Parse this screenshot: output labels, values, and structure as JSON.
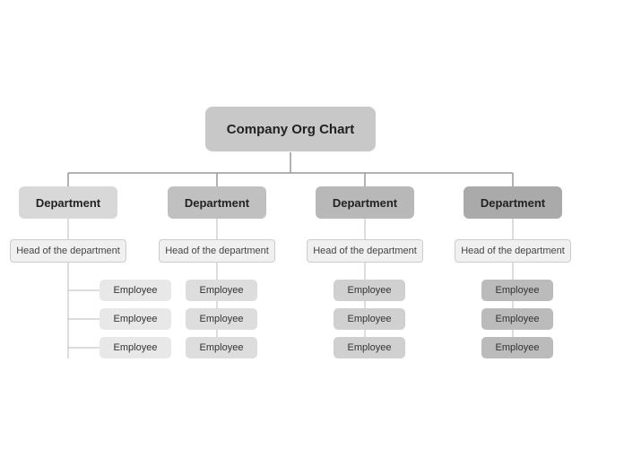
{
  "title": "Company Org Chart",
  "departments": [
    {
      "label": "Department",
      "head": "Head of the department",
      "employees": [
        "Employee",
        "Employee",
        "Employee"
      ],
      "col": 1
    },
    {
      "label": "Department",
      "head": "Head of the department",
      "employees": [
        "Employee",
        "Employee",
        "Employee"
      ],
      "col": 2
    },
    {
      "label": "Department",
      "head": "Head of the department",
      "employees": [
        "Employee",
        "Employee",
        "Employee"
      ],
      "col": 3
    },
    {
      "label": "Department",
      "head": "Head of the department",
      "employees": [
        "Employee",
        "Employee",
        "Employee"
      ],
      "col": 4
    }
  ]
}
